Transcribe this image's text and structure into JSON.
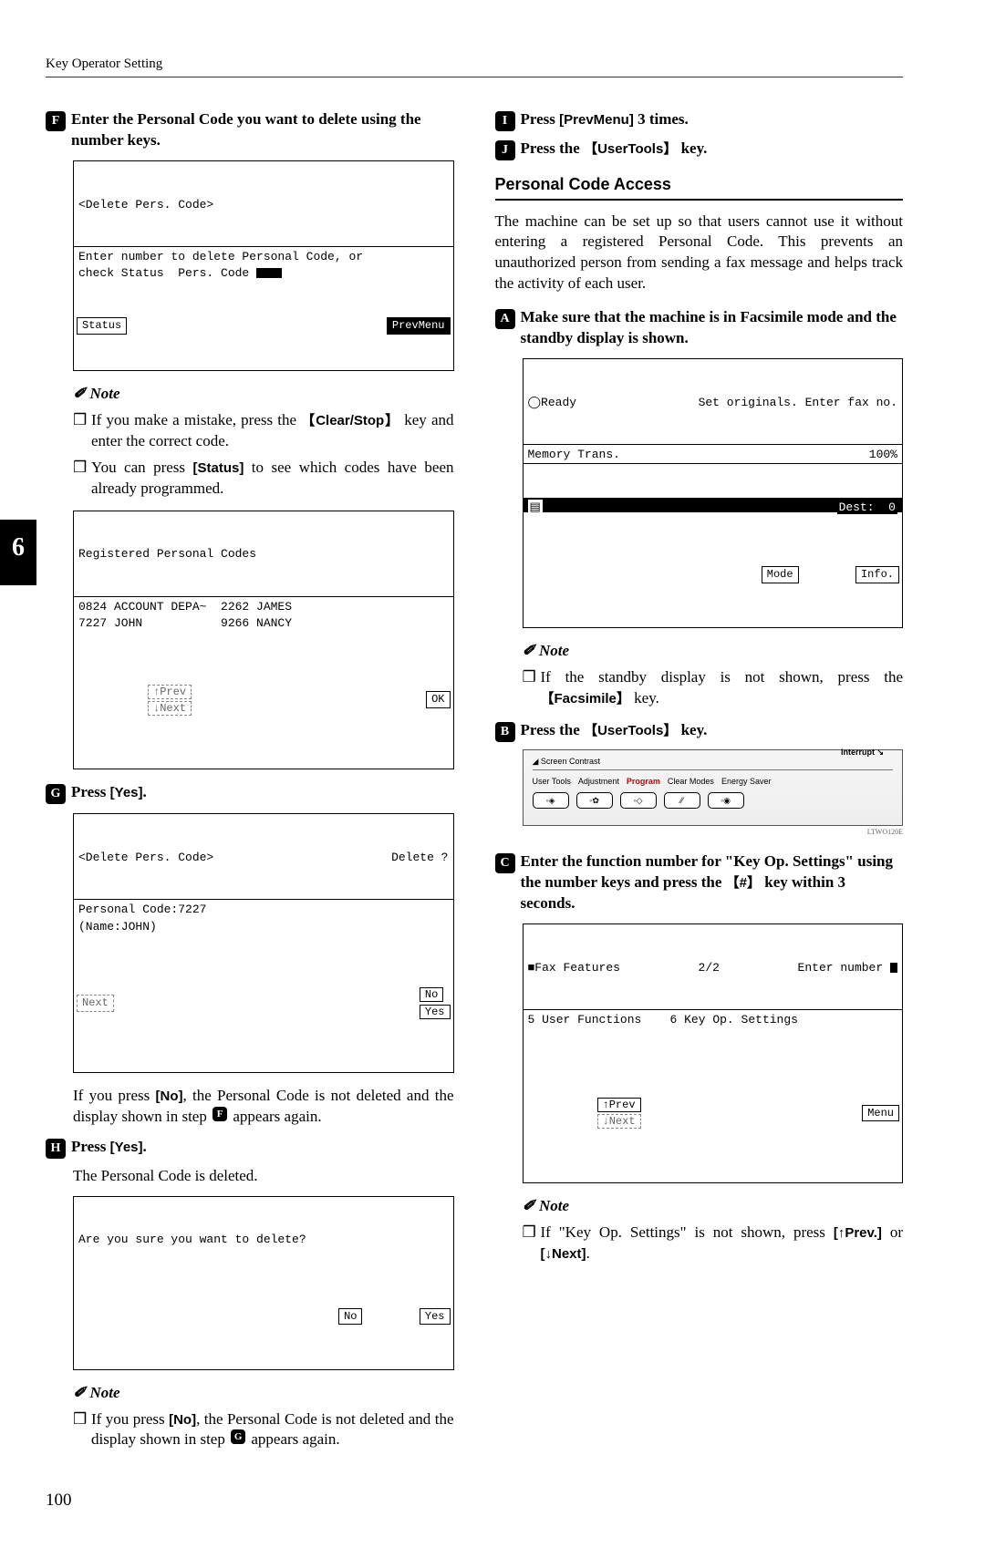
{
  "header": "Key Operator Setting",
  "sideTab": "6",
  "left": {
    "step6": {
      "num": "F",
      "text": "Enter the Personal Code you want to delete using the number keys."
    },
    "lcd6": {
      "top": "<Delete Pers. Code>",
      "body_line1": "Enter number to delete Personal Code, or",
      "body_line2": "check Status  Pers. Code ",
      "btn_left": "Status",
      "btn_right": "PrevMenu"
    },
    "note6_head": "✐ Note",
    "note6_items": [
      {
        "pre": "If you make a mistake, press the ",
        "key1": "Clear/Stop",
        "post": " key and enter the correct code."
      },
      {
        "pre": "You can press ",
        "key1": "[Status]",
        "post": " to see which codes have been already programmed."
      }
    ],
    "lcd_codes": {
      "top": "Registered Personal Codes",
      "line1": "0824 ACCOUNT DEPA~  2262 JAMES",
      "line2": "7227 JOHN           9266 NANCY",
      "btn_prev": "↑Prev",
      "btn_next": "↓Next",
      "btn_ok": "OK"
    },
    "step7": {
      "num": "G",
      "pre": "Press ",
      "key": "[Yes]",
      "post": "."
    },
    "lcd7": {
      "top_left": "<Delete Pers. Code>",
      "top_right": "Delete ?",
      "line1": "Personal Code:7227",
      "line2": "(Name:JOHN)",
      "btn_prev": "Next",
      "btn_no": "No",
      "btn_yes": "Yes"
    },
    "para7": {
      "pre": "If you press ",
      "key": "[No]",
      "mid": ", the Personal Code is not deleted and the display shown in step ",
      "step": "F",
      "post": " appears again."
    },
    "step8": {
      "num": "H",
      "pre": "Press ",
      "key": "[Yes]",
      "post": "."
    },
    "para8": "The Personal Code is deleted.",
    "lcd8": {
      "body": "Are you sure you want to delete?",
      "btn_no": "No",
      "btn_yes": "Yes"
    },
    "note8_head": "✐ Note",
    "note8_item": {
      "pre": "If you press ",
      "key": "[No]",
      "mid": ", the Personal Code is not deleted and the display shown in step ",
      "step": "G",
      "post": " appears again."
    }
  },
  "right": {
    "step9": {
      "num": "I",
      "pre": "Press ",
      "key": "[PrevMenu]",
      "post": " 3 times."
    },
    "step10": {
      "num": "J",
      "pre": "Press the ",
      "key": "UserTools",
      "post": " key."
    },
    "subhead": "Personal Code Access",
    "intro": "The machine can be set up so that users cannot use it without entering a registered Personal Code. This prevents an unauthorized person from sending a fax message and helps track the activity of each user.",
    "step1": {
      "num": "A",
      "text": "Make sure that the machine is in Facsimile mode and the standby display is shown."
    },
    "lcd1": {
      "left": "◯Ready",
      "right": "Set originals. Enter fax no.",
      "line2_left": "Memory Trans.",
      "line2_right": "100%",
      "dest": "Dest:  0",
      "btn_mode": "Mode",
      "btn_info": "Info."
    },
    "note1_head": "✐ Note",
    "note1_item": {
      "pre": "If the standby display is not shown, press the ",
      "key": "Facsimile",
      "post": " key."
    },
    "step2": {
      "num": "B",
      "pre": "Press the ",
      "key": "UserTools",
      "post": " key."
    },
    "panel": {
      "contrast": "Screen Contrast",
      "interrupt": "Interrupt",
      "keys": [
        "User Tools",
        "Adjustment",
        "Program",
        "Clear Modes",
        "Energy Saver"
      ],
      "tiny": "LTWO120E"
    },
    "step3": {
      "num": "C",
      "pre": "Enter the function number for \"Key Op. Settings\" using the number keys and press the ",
      "key": "#",
      "post": " key within 3 seconds."
    },
    "lcd3": {
      "left": "■Fax Features",
      "mid": "2/2",
      "right": "Enter number",
      "line2": "5 User Functions    6 Key Op. Settings",
      "btn_prev": "↑Prev",
      "btn_next": "↓Next",
      "btn_menu": "Menu"
    },
    "note3_head": "✐ Note",
    "note3_item": {
      "pre": "If \"Key Op. Settings\" is not shown, press ",
      "key1": "[↑Prev.]",
      "mid": " or ",
      "key2": "[↓Next]",
      "post": "."
    }
  },
  "pageNumber": "100"
}
